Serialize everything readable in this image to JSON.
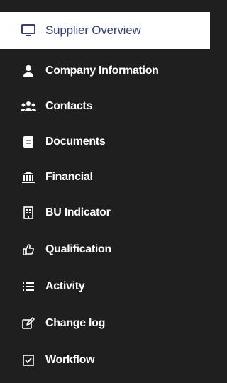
{
  "sidebar": {
    "colors": {
      "background": "#1f1f1f",
      "active_bg": "#ffffff",
      "active_text": "#34417a",
      "text": "#ffffff"
    },
    "items": [
      {
        "label": "Supplier Overview",
        "icon": "monitor-icon",
        "active": true
      },
      {
        "label": "Company Information",
        "icon": "user-icon"
      },
      {
        "label": "Contacts",
        "icon": "users-icon"
      },
      {
        "label": "Documents",
        "icon": "document-icon"
      },
      {
        "label": "Financial",
        "icon": "bank-icon"
      },
      {
        "label": "BU Indicator",
        "icon": "building-icon"
      },
      {
        "label": "Qualification",
        "icon": "thumbs-up-icon"
      },
      {
        "label": "Activity",
        "icon": "list-icon"
      },
      {
        "label": "Change log",
        "icon": "edit-icon"
      },
      {
        "label": "Workflow",
        "icon": "checkbox-icon"
      }
    ]
  }
}
